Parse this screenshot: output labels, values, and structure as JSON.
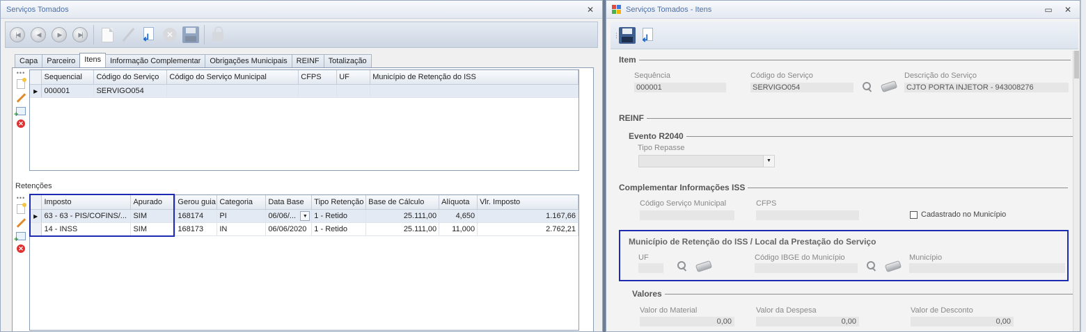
{
  "left_window": {
    "title": "Serviços Tomados",
    "tabs": [
      "Capa",
      "Parceiro",
      "Itens",
      "Informação Complementar",
      "Obrigações Municipais",
      "REINF",
      "Totalização"
    ],
    "active_tab": "Itens",
    "items_grid": {
      "columns": [
        "Sequencial",
        "Código do Serviço",
        "Código do Serviço Municipal",
        "CFPS",
        "UF",
        "Município de Retenção do ISS"
      ],
      "rows": [
        [
          "000001",
          "SERVIGO054",
          "",
          "",
          "",
          ""
        ]
      ]
    },
    "retencoes_label": "Retenções",
    "retencoes_grid": {
      "columns": [
        "Imposto",
        "Apurado",
        "Gerou guia",
        "Categoria",
        "Data Base",
        "Tipo Retenção",
        "Base de Cálculo",
        "Alíquota",
        "Vlr. Imposto"
      ],
      "rows": [
        [
          "63 - 63 - PIS/COFINS/...",
          "SIM",
          "168174",
          "PI",
          "06/06/...",
          "1 - Retido",
          "25.111,00",
          "4,650",
          "1.167,66"
        ],
        [
          "14 - INSS",
          "SIM",
          "168173",
          "IN",
          "06/06/2020",
          "1 - Retido",
          "25.111,00",
          "11,000",
          "2.762,21"
        ]
      ]
    }
  },
  "right_window": {
    "title": "Serviços Tomados - Itens",
    "item_group": {
      "title": "Item",
      "sequencia_label": "Sequência",
      "sequencia_value": "000001",
      "codigo_label": "Código do Serviço",
      "codigo_value": "SERVIGO054",
      "descricao_label": "Descrição do Serviço",
      "descricao_value": "CJTO PORTA INJETOR - 943008276"
    },
    "reinf_group": {
      "title": "REINF",
      "evento_title": "Evento R2040",
      "tipo_repasse_label": "Tipo Repasse",
      "tipo_repasse_value": ""
    },
    "iss_group": {
      "title": "Complementar Informações ISS",
      "codigo_municipal_label": "Código Serviço Municipal",
      "cfps_label": "CFPS",
      "cadastrado_label": "Cadastrado no Município",
      "cadastrado_checked": false
    },
    "municipio_group": {
      "title": "Município de Retenção do ISS / Local da Prestação  do Serviço",
      "uf_label": "UF",
      "ibge_label": "Código IBGE do Município",
      "municipio_label": "Município"
    },
    "valores_group": {
      "title": "Valores",
      "material_label": "Valor do Material",
      "material_value": "0,00",
      "despesa_label": "Valor da Despesa",
      "despesa_value": "0,00",
      "desconto_label": "Valor de Desconto",
      "desconto_value": "0,00"
    }
  },
  "colors": {
    "highlight_border": "#1c2bb0",
    "title_text": "#4a6fa8",
    "desktop": "#6d7d93"
  },
  "icons": {
    "toolbar_left": [
      "first-record-icon",
      "prev-record-icon",
      "next-record-icon",
      "last-record-icon",
      "new-doc-icon",
      "edit-icon",
      "undo-icon",
      "delete-icon",
      "save-icon",
      "lock-icon"
    ],
    "toolbar_right": [
      "save-icon",
      "undo-icon"
    ]
  }
}
